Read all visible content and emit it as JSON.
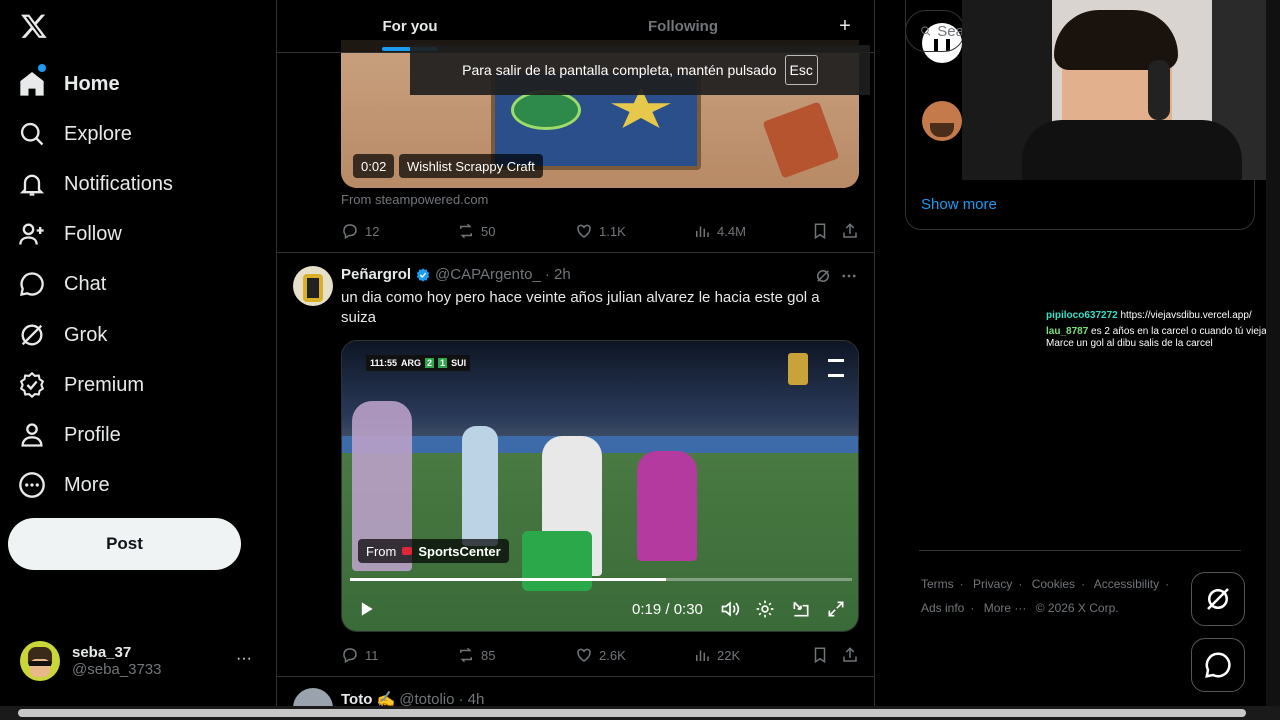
{
  "nav": {
    "items": [
      {
        "label": "Home",
        "icon": "home-icon"
      },
      {
        "label": "Explore",
        "icon": "search-icon"
      },
      {
        "label": "Notifications",
        "icon": "bell-icon"
      },
      {
        "label": "Follow",
        "icon": "follow-icon"
      },
      {
        "label": "Chat",
        "icon": "chat-icon"
      },
      {
        "label": "Grok",
        "icon": "grok-icon"
      },
      {
        "label": "Premium",
        "icon": "premium-icon"
      },
      {
        "label": "Profile",
        "icon": "person-icon"
      },
      {
        "label": "More",
        "icon": "more-circle-icon"
      }
    ],
    "post_label": "Post"
  },
  "account": {
    "name": "seba_37",
    "handle": "@seba_3733",
    "more": "···"
  },
  "tabs": {
    "for_you": "For you",
    "following": "Following",
    "plus": "+"
  },
  "fullscreen_notice": {
    "text": "Para salir de la pantalla completa, mantén pulsado",
    "key": "Esc"
  },
  "tweet1": {
    "video_time": "0:02",
    "video_title": "Wishlist Scrappy Craft",
    "source": "From steampowered.com",
    "replies": "12",
    "reposts": "50",
    "likes": "1.1K",
    "views": "4.4M"
  },
  "tweet2": {
    "name": "Peñargrol",
    "handle": "@CAPArgento_",
    "time": "· 2h",
    "text": "un dia como hoy pero hace veinte años julian alvarez le hacia este gol a suiza",
    "scoreboard": {
      "clock": "111:55",
      "team1": "ARG",
      "score1": "2",
      "score2": "1",
      "team2": "SUI"
    },
    "from_label": "From",
    "from_source": "SportsCenter",
    "video_time": "0:19 / 0:30",
    "progress": 0.63,
    "replies": "11",
    "reposts": "85",
    "likes": "2.6K",
    "views": "22K"
  },
  "tweet3": {
    "name": "Toto ✍️",
    "handle": "@totolio",
    "time": "· 4h"
  },
  "right": {
    "search_placeholder": "Sea",
    "show_more": "Show more",
    "footer": [
      "Terms",
      "·",
      "Privacy",
      "·",
      "Cookies",
      "·",
      "Accessibility",
      "·",
      "Ads info",
      "·",
      "More ···",
      "© 2026 X Corp."
    ]
  },
  "chat": [
    {
      "user": "pipiloco637272",
      "msg": "https://viejavsdibu.vercel.app/"
    },
    {
      "user": "lau_8787",
      "msg": "es 2 años en la carcel o cuando tú vieja Marce un gol al dibu salis de la carcel"
    }
  ],
  "colors": {
    "accent": "#1d9bf0",
    "bg": "#000000",
    "border": "#2f3336",
    "muted": "#71767b"
  }
}
